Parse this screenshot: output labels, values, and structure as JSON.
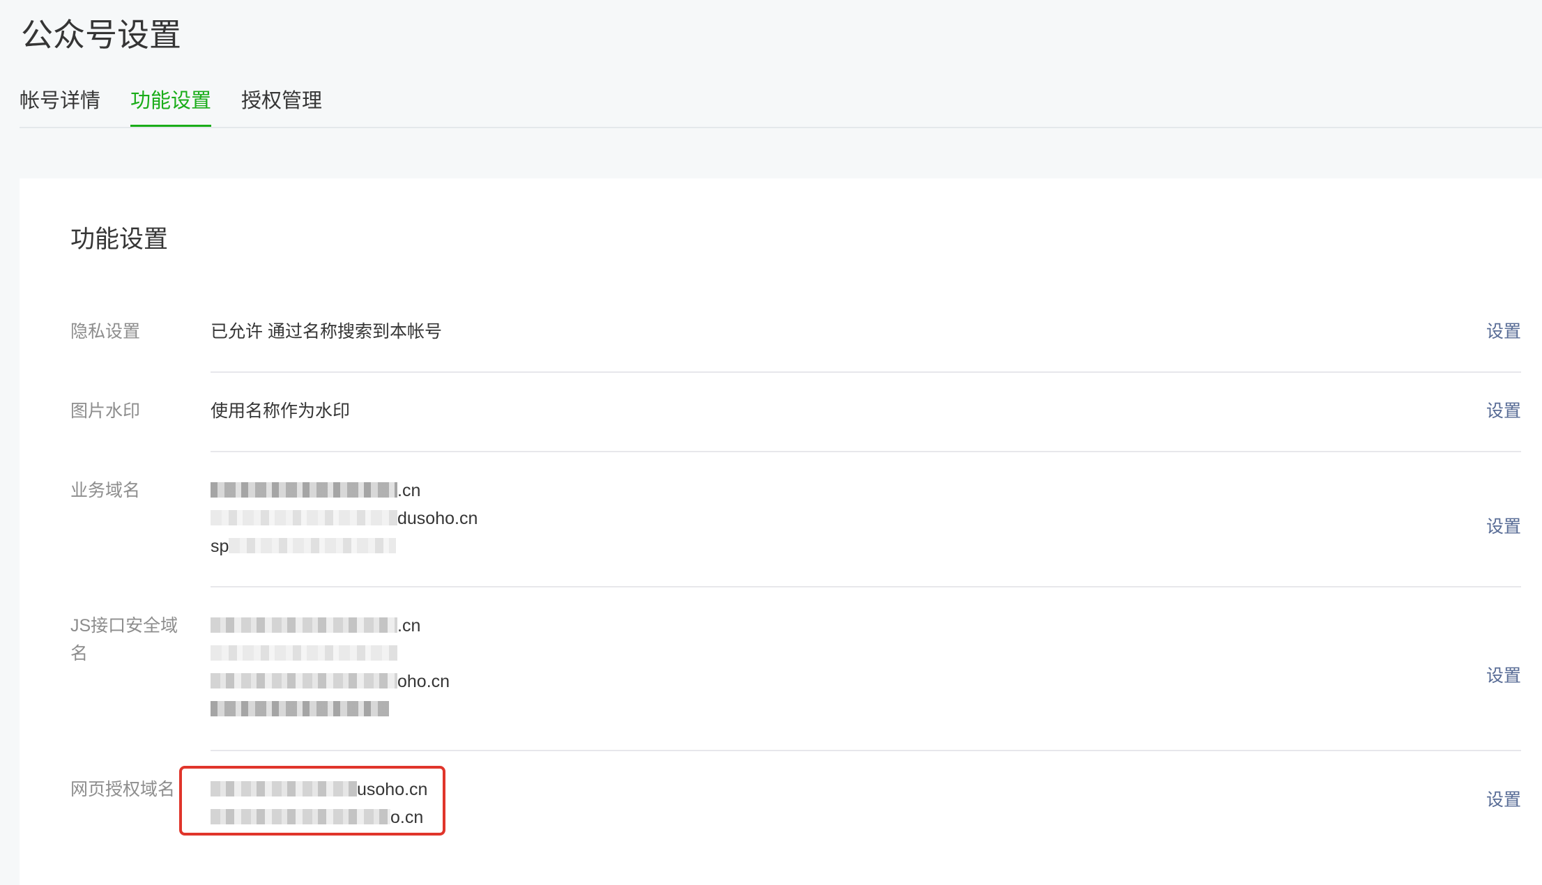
{
  "page": {
    "title": "公众号设置"
  },
  "tabs": [
    {
      "label": "帐号详情",
      "active": false
    },
    {
      "label": "功能设置",
      "active": true
    },
    {
      "label": "授权管理",
      "active": false
    }
  ],
  "section": {
    "title": "功能设置",
    "action_label": "设置",
    "rows": [
      {
        "label": "隐私设置",
        "value": "已允许 通过名称搜索到本帐号"
      },
      {
        "label": "图片水印",
        "value": "使用名称作为水印"
      },
      {
        "label": "业务域名",
        "domains": [
          ".cn",
          "dusoho.cn",
          "sp"
        ]
      },
      {
        "label": "JS接口安全域名",
        "domains": [
          ".cn",
          "",
          "oho.cn",
          ""
        ]
      },
      {
        "label": "网页授权域名",
        "domains": [
          "usoho.cn",
          "o.cn"
        ]
      }
    ]
  },
  "colors": {
    "accent_green": "#1aad19",
    "link_blue": "#576b95",
    "highlight_red": "#e0352b"
  }
}
